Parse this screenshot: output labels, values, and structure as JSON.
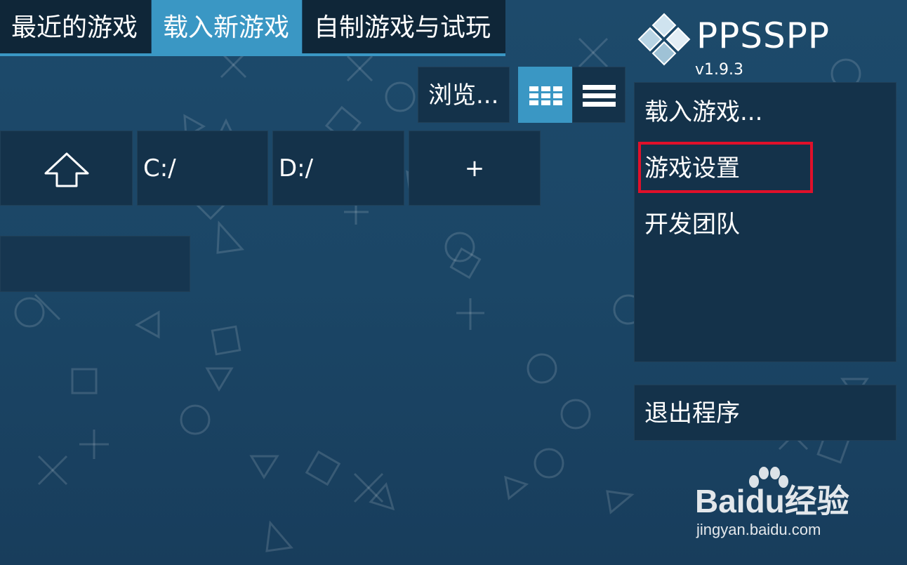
{
  "tabs": [
    {
      "label": "最近的游戏",
      "active": false
    },
    {
      "label": "载入新游戏",
      "active": true
    },
    {
      "label": "自制游戏与试玩",
      "active": false
    }
  ],
  "toolbar": {
    "browse_label": "浏览...",
    "grid_view_icon": "grid-icon",
    "list_view_icon": "list-icon"
  },
  "directories": [
    {
      "icon": "up-arrow-icon",
      "label": ""
    },
    {
      "label": "C:/"
    },
    {
      "label": "D:/"
    },
    {
      "label": "+"
    }
  ],
  "brand": {
    "name": "PPSSPP",
    "version": "v1.9.3"
  },
  "side_menu": {
    "items": [
      {
        "label": "载入游戏..."
      },
      {
        "label": "游戏设置",
        "highlighted": true
      },
      {
        "label": "开发团队"
      }
    ],
    "exit_label": "退出程序"
  },
  "watermark": {
    "brand": "Baidu经验",
    "url": "jingyan.baidu.com"
  },
  "colors": {
    "accent": "#3a97c4",
    "background": "#1b4666",
    "panel": "#14324a",
    "highlight_box": "#e0102a"
  }
}
